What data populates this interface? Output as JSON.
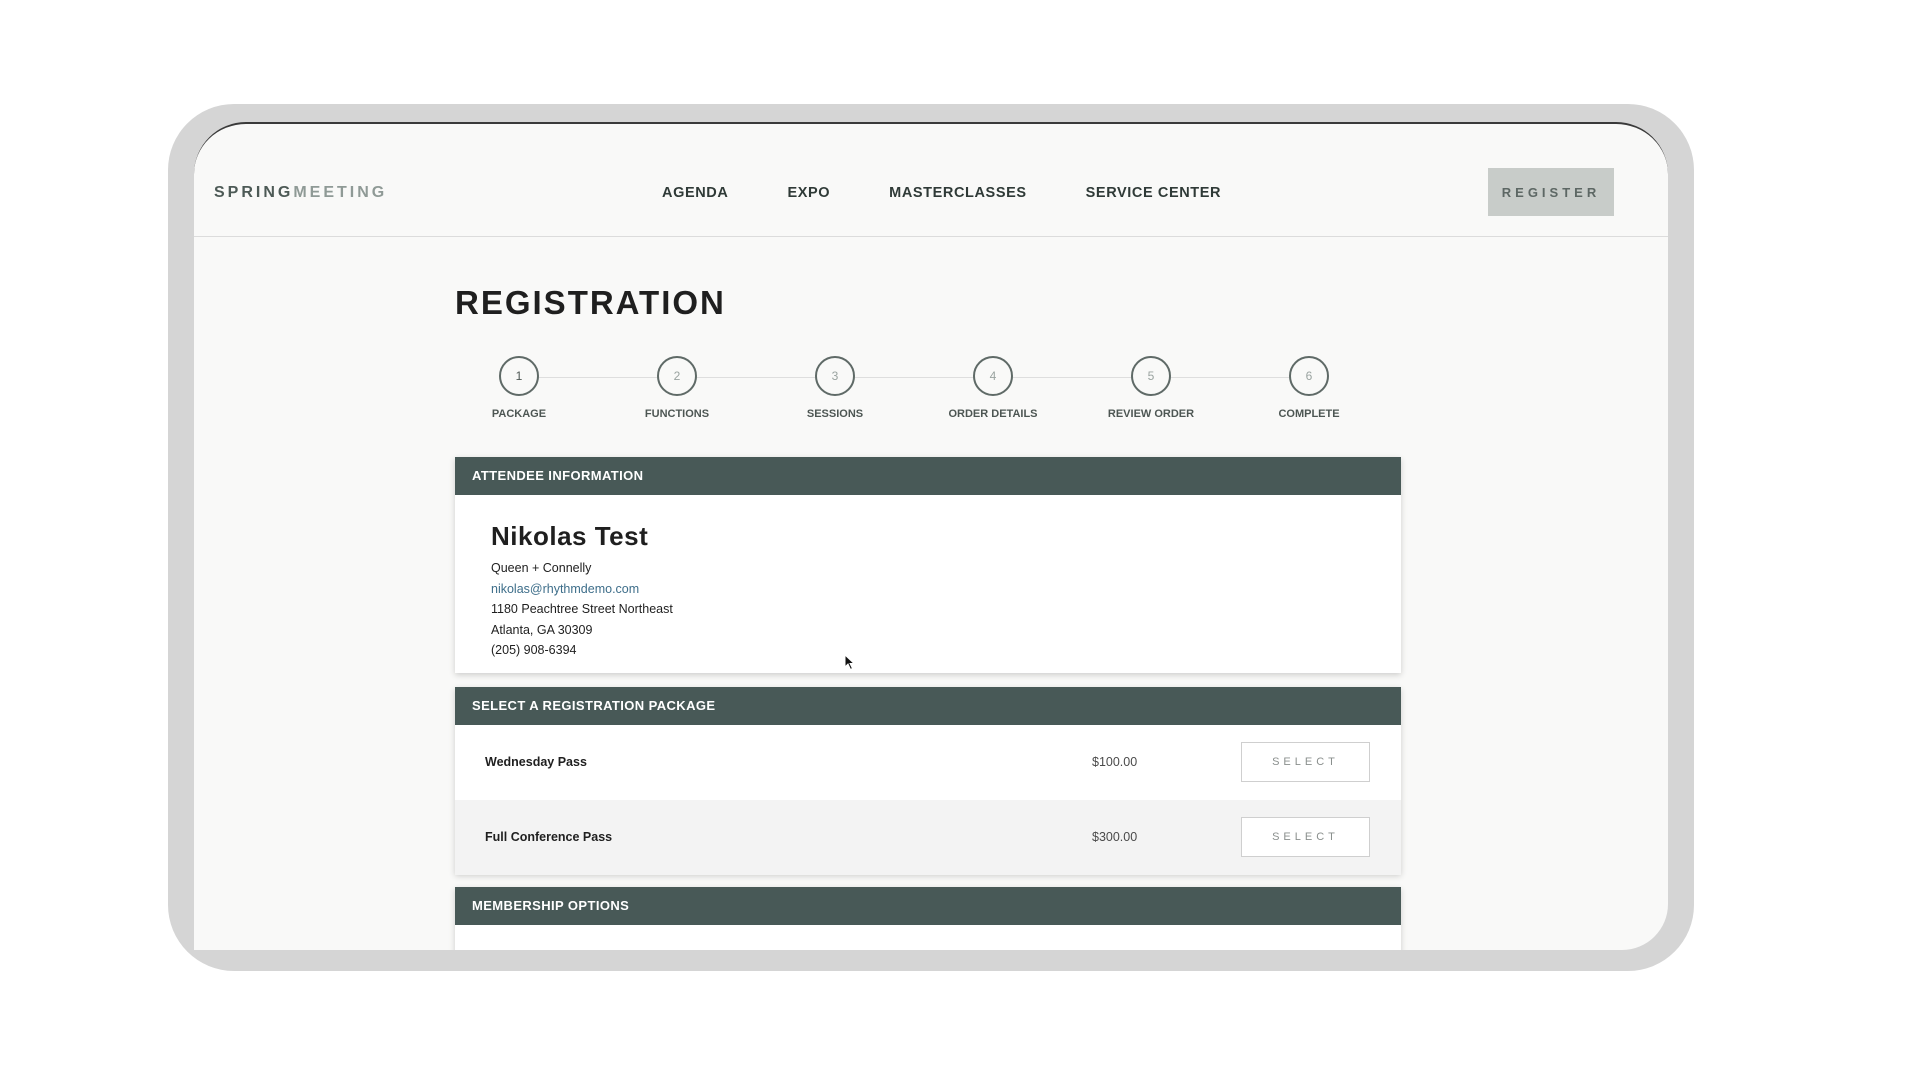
{
  "header": {
    "logo_part1": "SPRING",
    "logo_part2": "MEETING",
    "nav": [
      "AGENDA",
      "EXPO",
      "MASTERCLASSES",
      "SERVICE CENTER"
    ],
    "register_label": "REGISTER"
  },
  "page": {
    "title": "REGISTRATION"
  },
  "steps": [
    {
      "num": "1",
      "label": "PACKAGE"
    },
    {
      "num": "2",
      "label": "FUNCTIONS"
    },
    {
      "num": "3",
      "label": "SESSIONS"
    },
    {
      "num": "4",
      "label": "ORDER DETAILS"
    },
    {
      "num": "5",
      "label": "REVIEW ORDER"
    },
    {
      "num": "6",
      "label": "COMPLETE"
    }
  ],
  "attendee": {
    "heading": "ATTENDEE INFORMATION",
    "name": "Nikolas Test",
    "company": "Queen + Connelly",
    "email": "nikolas@rhythmdemo.com",
    "street": "1180 Peachtree Street Northeast",
    "city": "Atlanta, GA 30309",
    "phone": "(205) 908-6394"
  },
  "packages": {
    "heading": "SELECT A REGISTRATION PACKAGE",
    "items": [
      {
        "name": "Wednesday Pass",
        "price": "$100.00",
        "button": "SELECT"
      },
      {
        "name": "Full Conference Pass",
        "price": "$300.00",
        "button": "SELECT"
      }
    ]
  },
  "membership": {
    "heading": "MEMBERSHIP OPTIONS"
  },
  "colors": {
    "panel_header": "#485957",
    "email_link": "#3e6e8a",
    "register_button": "#c8ccc9"
  }
}
